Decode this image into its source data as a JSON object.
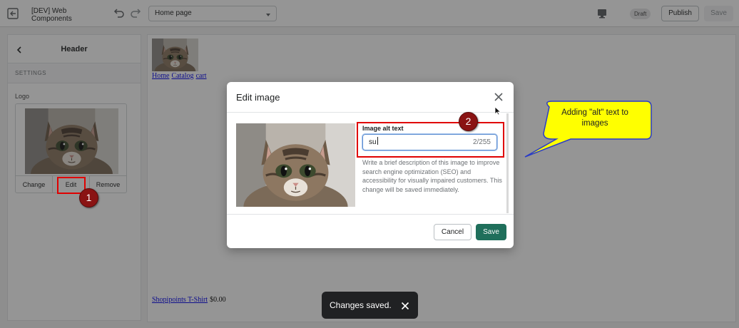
{
  "topbar": {
    "exit_icon": "exit-icon",
    "app_title": "[DEV] Web Components",
    "undo_icon": "undo-icon",
    "redo_icon": "redo-icon",
    "page_select_value": "Home page",
    "device_icon": "desktop-icon",
    "status_badge": "Draft",
    "publish_label": "Publish",
    "save_label": "Save"
  },
  "sidebar": {
    "title": "Header",
    "section_label": "SETTINGS",
    "logo_label": "Logo",
    "actions": [
      "Change",
      "Edit",
      "Remove"
    ]
  },
  "preview": {
    "nav_links": [
      "Home",
      "Catalog",
      "cart"
    ],
    "product_name": "Shopipoints T-Shirt",
    "product_price": "$0.00"
  },
  "modal": {
    "title": "Edit image",
    "field_label": "Image alt text",
    "field_value": "su",
    "field_counter": "2/255",
    "help_text": "Write a brief description of this image to improve search engine optimization (SEO) and accessibility for visually impaired customers. This change will be saved immediately.",
    "cancel_label": "Cancel",
    "save_label": "Save"
  },
  "annotations": {
    "marker_1": "1",
    "marker_2": "2",
    "callout": "Adding \"alt\" text to images",
    "highlight_color": "#e00000",
    "callout_fill": "#ffff00",
    "callout_border": "#2a3cc7"
  },
  "toast": {
    "message": "Changes saved."
  },
  "colors": {
    "primary_button": "#1f6f5b",
    "link": "#0000ee",
    "toast_bg": "#202123"
  }
}
